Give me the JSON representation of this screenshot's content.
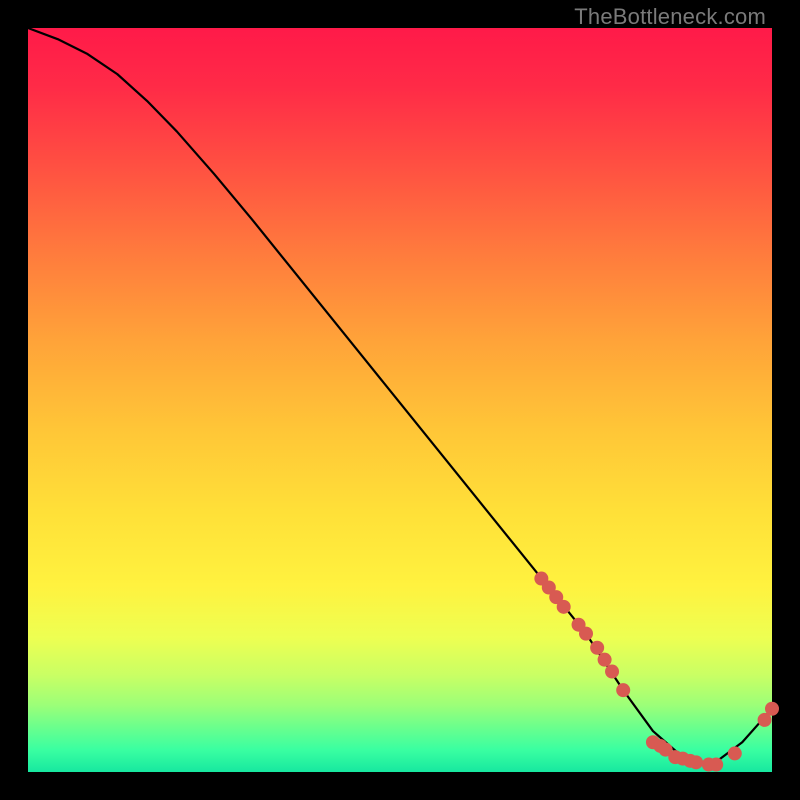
{
  "watermark": "TheBottleneck.com",
  "colors": {
    "marker": "#d85a52",
    "curve": "#000000",
    "frame_bg": "#000000"
  },
  "chart_data": {
    "type": "line",
    "title": "",
    "xlabel": "",
    "ylabel": "",
    "xlim": [
      0,
      100
    ],
    "ylim": [
      0,
      100
    ],
    "x": [
      0,
      4,
      8,
      12,
      16,
      20,
      25,
      30,
      35,
      40,
      45,
      50,
      55,
      60,
      65,
      70,
      75,
      80,
      84,
      88,
      92,
      96,
      100
    ],
    "y": [
      100,
      98.5,
      96.5,
      93.8,
      90.2,
      86.1,
      80.4,
      74.4,
      68.2,
      62.0,
      55.8,
      49.6,
      43.4,
      37.2,
      31.0,
      24.8,
      18.6,
      11.0,
      5.5,
      2.0,
      1.0,
      4.0,
      8.5
    ],
    "markers": [
      {
        "x": 69,
        "y": 26.0
      },
      {
        "x": 70,
        "y": 24.8
      },
      {
        "x": 71,
        "y": 23.5
      },
      {
        "x": 72,
        "y": 22.2
      },
      {
        "x": 74,
        "y": 19.8
      },
      {
        "x": 75,
        "y": 18.6
      },
      {
        "x": 76.5,
        "y": 16.7
      },
      {
        "x": 77.5,
        "y": 15.1
      },
      {
        "x": 78.5,
        "y": 13.5
      },
      {
        "x": 80,
        "y": 11.0
      },
      {
        "x": 84,
        "y": 4.0
      },
      {
        "x": 85,
        "y": 3.5
      },
      {
        "x": 85.7,
        "y": 3.0
      },
      {
        "x": 87,
        "y": 2.0
      },
      {
        "x": 88,
        "y": 1.8
      },
      {
        "x": 89,
        "y": 1.5
      },
      {
        "x": 89.8,
        "y": 1.3
      },
      {
        "x": 91.5,
        "y": 1.0
      },
      {
        "x": 92.5,
        "y": 1.0
      },
      {
        "x": 95,
        "y": 2.5
      },
      {
        "x": 99,
        "y": 7.0
      },
      {
        "x": 100,
        "y": 8.5
      }
    ]
  }
}
